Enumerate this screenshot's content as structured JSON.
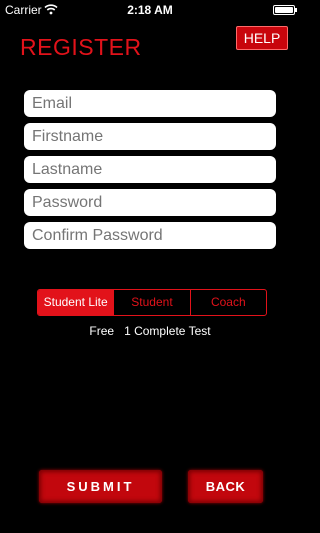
{
  "status_bar": {
    "carrier": "Carrier",
    "time": "2:18 AM",
    "wifi_icon": "wifi-icon",
    "battery_icon": "battery-icon"
  },
  "header": {
    "title": "REGISTER",
    "help_label": "HELP"
  },
  "form": {
    "email_placeholder": "Email",
    "firstname_placeholder": "Firstname",
    "lastname_placeholder": "Lastname",
    "password_placeholder": "Password",
    "confirm_password_placeholder": "Confirm Password"
  },
  "plan_selector": {
    "options": [
      "Student Lite",
      "Student",
      "Coach"
    ],
    "selected": "Student Lite",
    "info": "Free   1 Complete Test"
  },
  "actions": {
    "submit_label": "SUBMIT",
    "back_label": "BACK"
  },
  "colors": {
    "accent": "#e2121a",
    "button_red": "#c2070d",
    "background": "#000000"
  }
}
